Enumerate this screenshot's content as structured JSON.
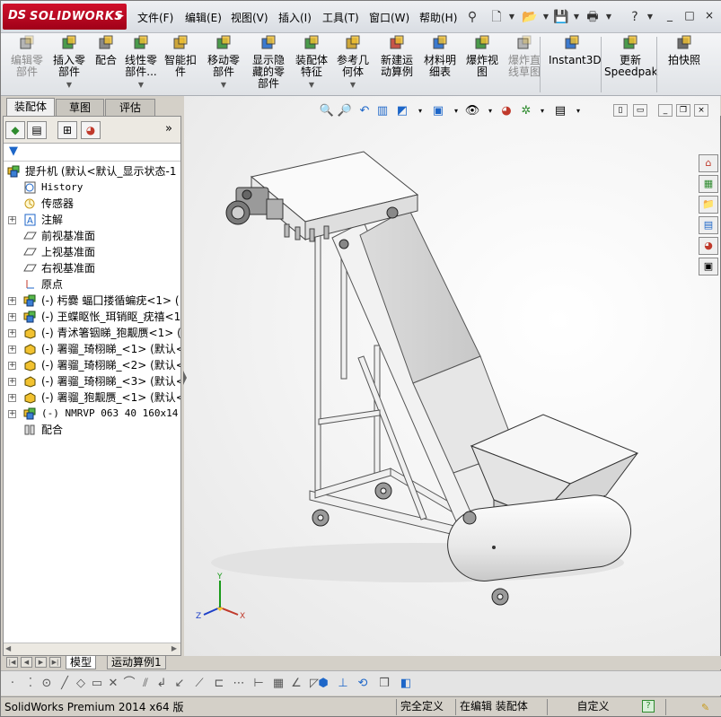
{
  "app": {
    "logo_ds": "DS",
    "logo_brand": "SOLIDWORKS"
  },
  "menu": [
    "文件(F)",
    "编辑(E)",
    "视图(V)",
    "插入(I)",
    "工具(T)",
    "窗口(W)",
    "帮助(H)"
  ],
  "window_buttons": [
    "_",
    "□",
    "×"
  ],
  "command_manager": [
    {
      "label": "编辑零\n部件",
      "disabled": true,
      "dropdown": false
    },
    {
      "label": "插入零\n部件",
      "disabled": false,
      "dropdown": true
    },
    {
      "label": "配合",
      "disabled": false,
      "dropdown": false
    },
    {
      "label": "线性零\n部件...",
      "disabled": false,
      "dropdown": true
    },
    {
      "label": "智能扣\n件",
      "disabled": false,
      "dropdown": false
    },
    {
      "label": "移动零\n部件",
      "disabled": false,
      "dropdown": true
    },
    {
      "label": "显示隐\n藏的零\n部件",
      "disabled": false,
      "dropdown": false
    },
    {
      "label": "装配体\n特征",
      "disabled": false,
      "dropdown": true
    },
    {
      "label": "参考几\n何体",
      "disabled": false,
      "dropdown": true
    },
    {
      "label": "新建运\n动算例",
      "disabled": false,
      "dropdown": false
    },
    {
      "label": "材料明\n细表",
      "disabled": false,
      "dropdown": false
    },
    {
      "label": "爆炸视\n图",
      "disabled": false,
      "dropdown": false
    },
    {
      "label": "爆炸直\n线草图",
      "disabled": true,
      "dropdown": false
    },
    {
      "label": "Instant3D",
      "disabled": false,
      "dropdown": false
    },
    {
      "label": "更新\nSpeedpak",
      "disabled": false,
      "dropdown": false
    },
    {
      "label": "拍快照",
      "disabled": false,
      "dropdown": false
    }
  ],
  "tabs": [
    "装配体",
    "草图",
    "评估"
  ],
  "panel_more": "»",
  "tree": {
    "root": "提升机  (默认<默认_显示状态-1",
    "items": [
      {
        "label": "History",
        "mono": true,
        "expand": false,
        "icon": "history-icon"
      },
      {
        "label": "传感器",
        "mono": false,
        "expand": false,
        "icon": "sensor-icon"
      },
      {
        "label": "注解",
        "mono": false,
        "expand": true,
        "icon": "annotation-icon"
      },
      {
        "label": "前视基准面",
        "mono": false,
        "expand": false,
        "icon": "plane-icon"
      },
      {
        "label": "上视基准面",
        "mono": false,
        "expand": false,
        "icon": "plane-icon"
      },
      {
        "label": "右视基准面",
        "mono": false,
        "expand": false,
        "icon": "plane-icon"
      },
      {
        "label": "原点",
        "mono": false,
        "expand": false,
        "icon": "origin-icon"
      },
      {
        "label": "(-) 杇爨 蝠囗搂循蝙疣<1> (",
        "mono": false,
        "expand": true,
        "icon": "subassembly-icon"
      },
      {
        "label": "(-) 玊蝶眍怅_珥销眍_疣禧<1",
        "mono": false,
        "expand": true,
        "icon": "subassembly-icon"
      },
      {
        "label": "(-) 青沭箸铟睇_狍觏赝<1> (",
        "mono": false,
        "expand": true,
        "icon": "part-icon"
      },
      {
        "label": "(-) 署骝_琦栩睇_<1> (默认<",
        "mono": false,
        "expand": true,
        "icon": "part-icon"
      },
      {
        "label": "(-) 署骝_琦栩睇_<2> (默认<",
        "mono": false,
        "expand": true,
        "icon": "part-icon"
      },
      {
        "label": "(-) 署骝_琦栩睇_<3> (默认<",
        "mono": false,
        "expand": true,
        "icon": "part-icon"
      },
      {
        "label": "(-) 署骝_狍觏赝_<1> (默认<",
        "mono": false,
        "expand": true,
        "icon": "part-icon"
      },
      {
        "label": "(-) NMRVP 063 40 160x14 25",
        "mono": true,
        "expand": true,
        "icon": "subassembly-icon"
      },
      {
        "label": "配合",
        "mono": false,
        "expand": false,
        "icon": "mates-icon"
      }
    ]
  },
  "bottom_tabs": [
    "模型",
    "运动算例1"
  ],
  "status": {
    "app_version": "SolidWorks Premium 2014 x64 版",
    "definition": "完全定义",
    "mode": "在编辑 装配体",
    "units": "自定义",
    "help": "?"
  },
  "triad": {
    "x": "X",
    "y": "Y",
    "z": "Z"
  },
  "colors": {
    "logo_red": "#c8102e",
    "accent_blue": "#1d66c8"
  }
}
